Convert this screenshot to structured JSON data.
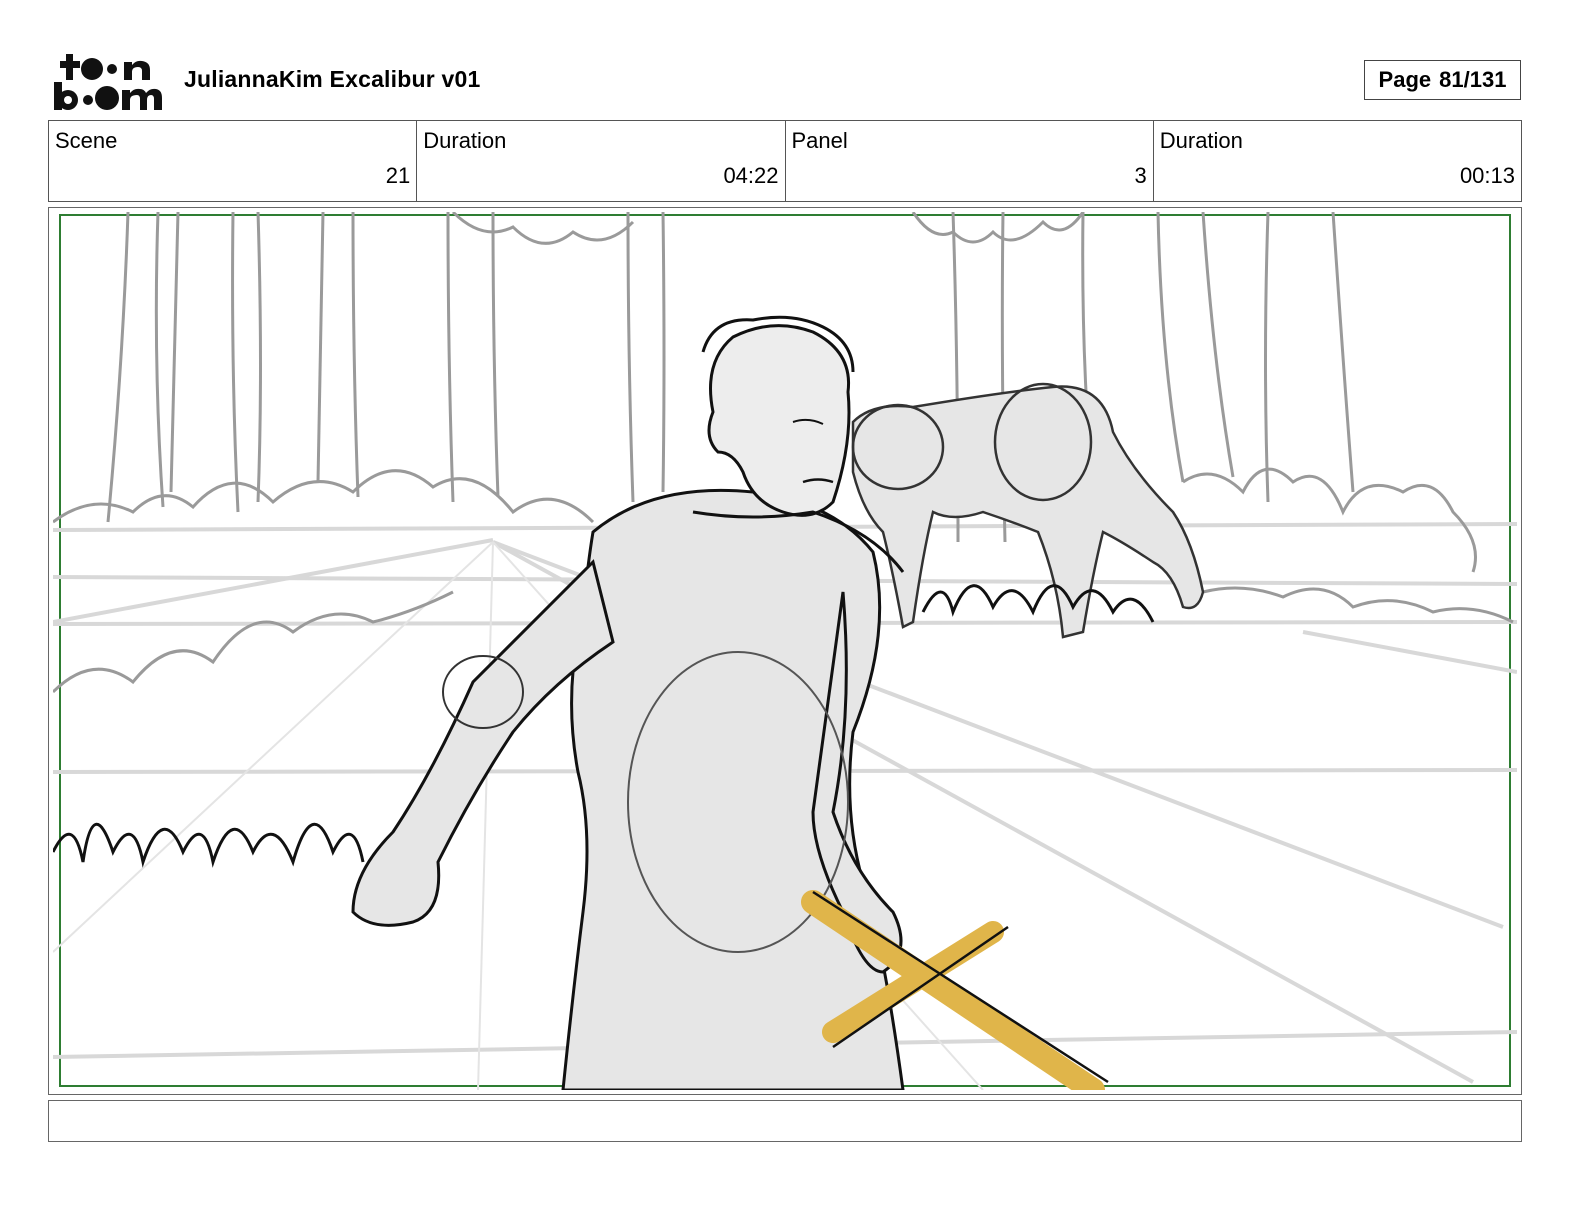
{
  "header": {
    "logo_icon": "toonboom-logo",
    "project_title": "JuliannaKim Excalibur v01",
    "page_label": "Page",
    "page_number": "81/131"
  },
  "info": {
    "scene_label": "Scene",
    "scene_value": "21",
    "scene_duration_label": "Duration",
    "scene_duration_value": "04:22",
    "panel_label": "Panel",
    "panel_value": "3",
    "panel_duration_label": "Duration",
    "panel_duration_value": "00:13"
  },
  "panel": {
    "image_icon": "storyboard-sketch",
    "frame_color": "#2e7d32",
    "sword_color": "#e0b54a"
  },
  "notes": {
    "text": ""
  }
}
